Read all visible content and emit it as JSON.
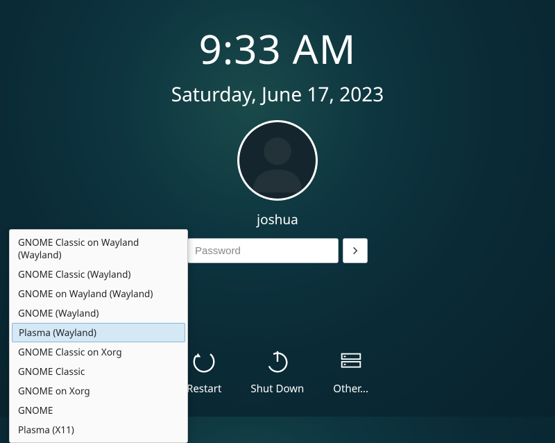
{
  "clock": {
    "time": "9:33 AM",
    "date": "Saturday, June 17, 2023"
  },
  "user": {
    "name": "joshua"
  },
  "password": {
    "placeholder": "Password"
  },
  "actions": {
    "restart": "Restart",
    "shutdown": "Shut Down",
    "other": "Other..."
  },
  "sessions": {
    "items": [
      {
        "label": "GNOME Classic on Wayland (Wayland)",
        "selected": false
      },
      {
        "label": "GNOME Classic (Wayland)",
        "selected": false
      },
      {
        "label": "GNOME on Wayland (Wayland)",
        "selected": false
      },
      {
        "label": "GNOME (Wayland)",
        "selected": false
      },
      {
        "label": "Plasma (Wayland)",
        "selected": true
      },
      {
        "label": "GNOME Classic on Xorg",
        "selected": false
      },
      {
        "label": "GNOME Classic",
        "selected": false
      },
      {
        "label": "GNOME on Xorg",
        "selected": false
      },
      {
        "label": "GNOME",
        "selected": false
      },
      {
        "label": "Plasma (X11)",
        "selected": false
      }
    ]
  }
}
